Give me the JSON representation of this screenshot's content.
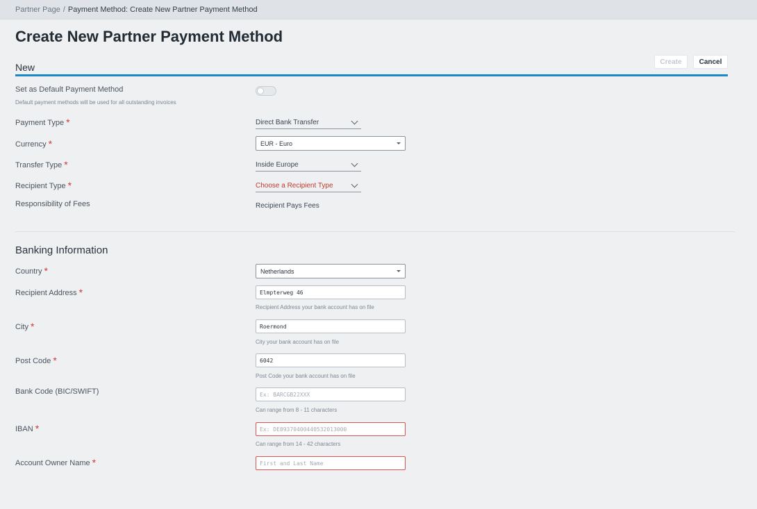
{
  "breadcrumb": {
    "parent": "Partner Page",
    "separator": "/",
    "current": "Payment Method: Create New Partner Payment Method"
  },
  "page": {
    "title": "Create New Partner Payment Method",
    "tab": "New"
  },
  "actions": {
    "create_label": "Create",
    "cancel_label": "Cancel"
  },
  "general": {
    "default_label": "Set as Default Payment Method",
    "default_sublabel": "Default payment methods will be used for all outstanding invoices",
    "default_enabled": false,
    "payment_type_label": "Payment Type",
    "payment_type_value": "Direct Bank Transfer",
    "currency_label": "Currency",
    "currency_value": "EUR - Euro",
    "transfer_type_label": "Transfer Type",
    "transfer_type_value": "Inside Europe",
    "recipient_type_label": "Recipient Type",
    "recipient_type_placeholder": "Choose a Recipient Type",
    "fees_label": "Responsibility of Fees",
    "fees_value": "Recipient Pays Fees"
  },
  "banking": {
    "heading": "Banking Information",
    "country_label": "Country",
    "country_value": "Netherlands",
    "address_label": "Recipient Address",
    "address_value": "Elmpterweg 46",
    "address_help": "Recipient Address your bank account has on file",
    "city_label": "City",
    "city_value": "Roermond",
    "city_help": "City your bank account has on file",
    "postcode_label": "Post Code",
    "postcode_value": "6042",
    "postcode_help": "Post Code your bank account has on file",
    "bic_label": "Bank Code (BIC/SWIFT)",
    "bic_placeholder": "Ex: BARCGB22XXX",
    "bic_help": "Can range from 8 - 11 characters",
    "iban_label": "IBAN",
    "iban_placeholder": "Ex: DE89370400440532013000",
    "iban_help": "Can range from 14 - 42 characters",
    "owner_label": "Account Owner Name",
    "owner_placeholder": "First and Last Name"
  },
  "required_marker": "*",
  "colors": {
    "accent": "#1b86c9",
    "required": "#d0383a",
    "error_border": "#d9534f",
    "placeholder_select": "#c0392b"
  }
}
